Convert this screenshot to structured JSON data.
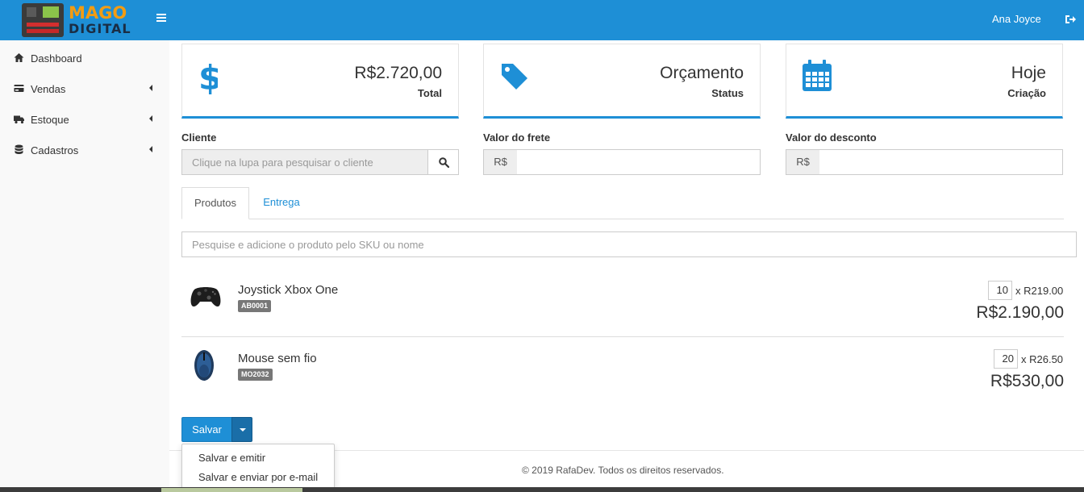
{
  "header": {
    "logo_line1": "MAGO",
    "logo_line2": "DIGITAL",
    "user_name": "Ana Joyce",
    "menu_icon": "bars-icon",
    "logout_icon": "sign-out-icon",
    "brand_color": "#1e8fd6"
  },
  "sidebar": {
    "items": [
      {
        "label": "Dashboard",
        "icon": "home-icon"
      },
      {
        "label": "Vendas",
        "icon": "credit-card-icon"
      },
      {
        "label": "Estoque",
        "icon": "truck-icon"
      },
      {
        "label": "Cadastros",
        "icon": "database-icon"
      }
    ]
  },
  "info_boxes": [
    {
      "value": "R$2.720,00",
      "label": "Total",
      "icon": "dollar-icon"
    },
    {
      "value": "Orçamento",
      "label": "Status",
      "icon": "tag-icon"
    },
    {
      "value": "Hoje",
      "label": "Criação",
      "icon": "calendar-icon"
    }
  ],
  "form": {
    "client_label": "Cliente",
    "client_placeholder": "Clique na lupa para pesquisar o cliente",
    "freight_label": "Valor do frete",
    "discount_label": "Valor do desconto",
    "currency_prefix": "R$"
  },
  "tabs": [
    {
      "label": "Produtos",
      "active": true
    },
    {
      "label": "Entrega",
      "active": false
    }
  ],
  "product_search_placeholder": "Pesquise e adicione o produto pelo SKU ou nome",
  "products": [
    {
      "name": "Joystick Xbox One",
      "sku": "AB0001",
      "qty": "10",
      "unit_price": "x R219.00",
      "total": "R$2.190,00"
    },
    {
      "name": "Mouse sem fio",
      "sku": "MO2032",
      "qty": "20",
      "unit_price": "x R26.50",
      "total": "R$530,00"
    }
  ],
  "actions": {
    "save_label": "Salvar",
    "dropdown": [
      "Salvar e emitir",
      "Salvar e enviar por e-mail"
    ]
  },
  "footer": {
    "text": "© 2019 RafaDev. Todos os direitos reservados."
  }
}
